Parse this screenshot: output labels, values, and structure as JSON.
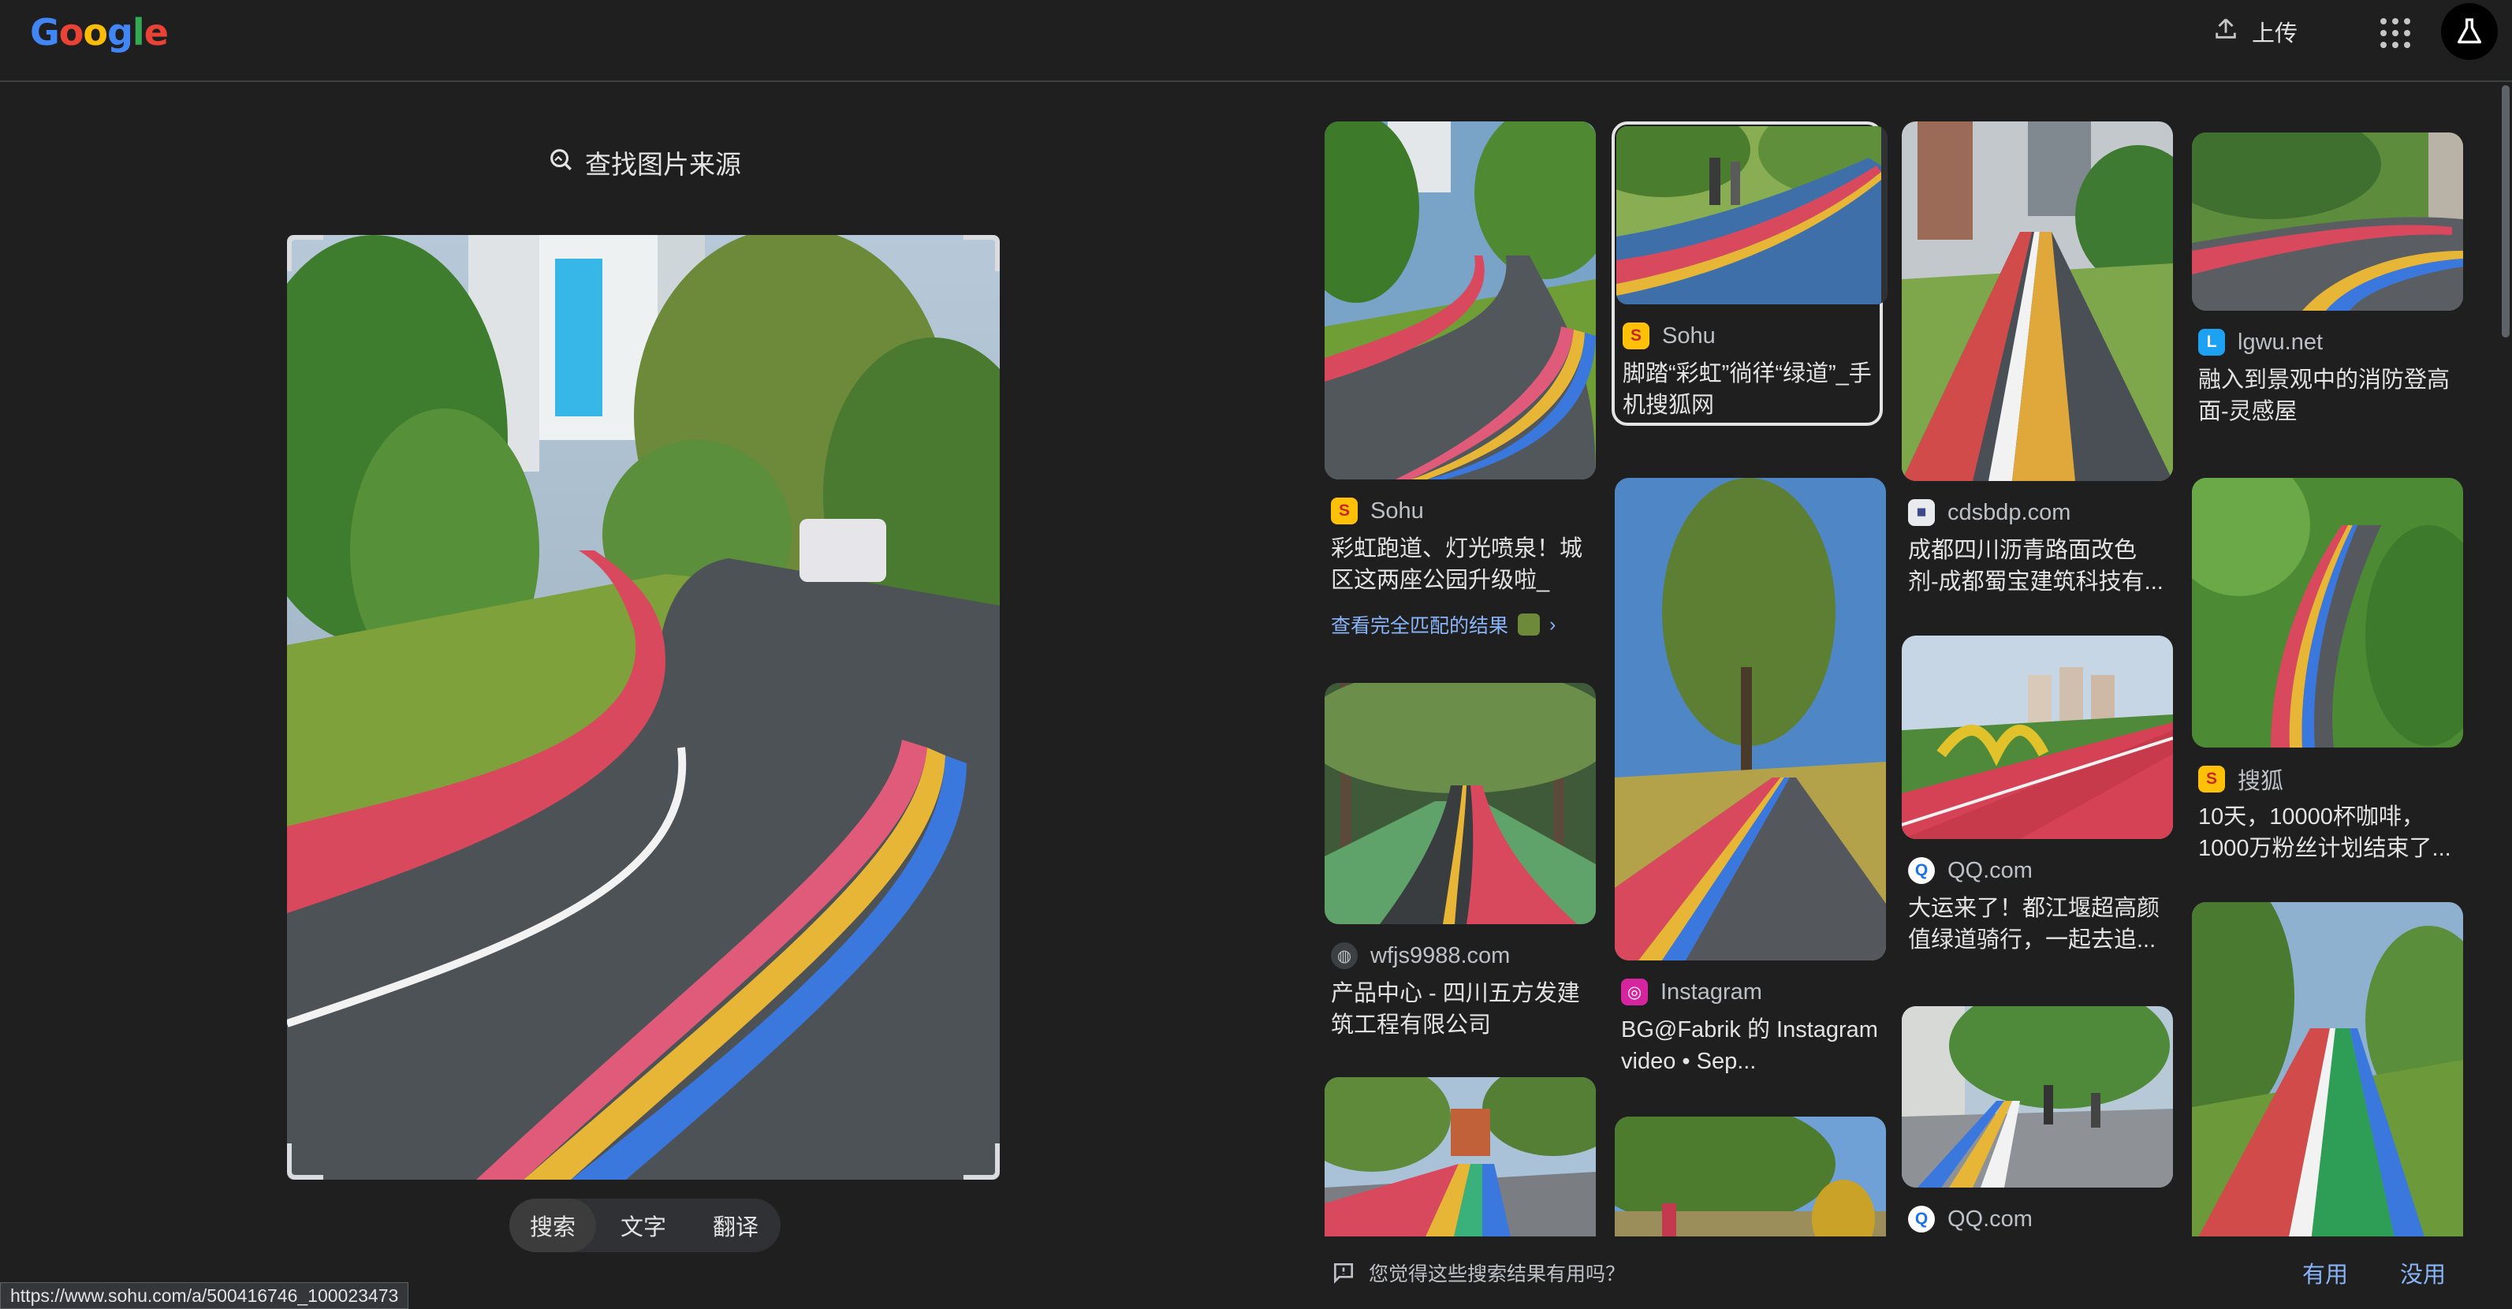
{
  "header": {
    "logo_letters": [
      {
        "ch": "G",
        "color": "#4285f4"
      },
      {
        "ch": "o",
        "color": "#ea4335"
      },
      {
        "ch": "o",
        "color": "#fbbc05"
      },
      {
        "ch": "g",
        "color": "#4285f4"
      },
      {
        "ch": "l",
        "color": "#34a853"
      },
      {
        "ch": "e",
        "color": "#ea4335"
      }
    ],
    "upload_label": "上传",
    "upload_icon": "upload-icon",
    "apps_icon": "apps-grid-icon",
    "labs_icon": "labs-flask-icon"
  },
  "left": {
    "find_source_label": "查找图片来源",
    "find_source_icon": "image-search-icon",
    "query_image_desc": "query-image",
    "modes": [
      "搜索",
      "文字",
      "翻译"
    ],
    "active_mode": "搜索"
  },
  "results": {
    "col1": [
      {
        "source": "Sohu",
        "favicon": "sohu-icon",
        "favicon_bg": "#ffc107",
        "favicon_char": "S",
        "title": "彩虹跑道、灯光喷泉！城区这两座公园升级啦_手...",
        "exact_link": "查看完全匹配的结果"
      },
      {
        "source": "wfjs9988.com",
        "favicon": "globe-icon",
        "favicon_bg": "#3c4043",
        "favicon_char": "◍",
        "title": "产品中心 - 四川五方发建筑工程有限公司"
      },
      {
        "source": "",
        "title": ""
      }
    ],
    "col2": [
      {
        "source": "Sohu",
        "favicon": "sohu-icon",
        "favicon_bg": "#ffc107",
        "favicon_char": "S",
        "title": "脚踏“彩虹”徜徉“绿道”_手机搜狐网"
      },
      {
        "source": "Instagram",
        "favicon": "instagram-icon",
        "favicon_bg": "#d6249f",
        "favicon_char": "◎",
        "title": "BG@Fabrik 的 Instagram video • Sep..."
      },
      {
        "source": "",
        "title": ""
      }
    ],
    "col3": [
      {
        "source": "cdsbdp.com",
        "favicon": "cdsbdp-icon",
        "favicon_bg": "#e8eaed",
        "favicon_char": "■",
        "title": "成都四川沥青路面改色剂-成都蜀宝建筑科技有..."
      },
      {
        "source": "QQ.com",
        "favicon": "qq-icon",
        "favicon_bg": "#ffffff",
        "favicon_char": "Q",
        "title": "大运来了！都江堰超高颜值绿道骑行，一起去追..."
      },
      {
        "source": "QQ.com",
        "favicon": "qq-icon",
        "favicon_bg": "#ffffff",
        "favicon_char": "Q",
        "title": ""
      }
    ],
    "col4": [
      {
        "source": "lgwu.net",
        "favicon": "lgwu-icon",
        "favicon_bg": "#1da1f2",
        "favicon_char": "L",
        "title": "融入到景观中的消防登高面-灵感屋"
      },
      {
        "source": "搜狐",
        "favicon": "sohu-icon",
        "favicon_bg": "#ffc107",
        "favicon_char": "S",
        "title": "10天，10000杯咖啡，1000万粉丝计划结束了..."
      },
      {
        "source": "",
        "title": ""
      }
    ]
  },
  "feedback": {
    "question": "您觉得这些搜索结果有用吗？",
    "yes": "有用",
    "no": "没用",
    "icon": "feedback-icon"
  },
  "status_url": "https://www.sohu.com/a/500416746_100023473"
}
